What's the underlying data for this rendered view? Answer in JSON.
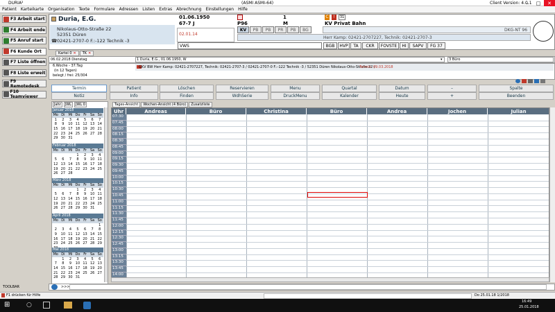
{
  "window": {
    "app": "DURIA²",
    "center": "(ASMI ASMI-64)",
    "version": "Client Version: 4.0.1"
  },
  "menu": [
    "Patient",
    "Karteikarte",
    "Organisation",
    "Texte",
    "Formulare",
    "Adressen",
    "Listen",
    "Extras",
    "Abrechnung",
    "Einstellungen",
    "Hilfe"
  ],
  "sidebar": [
    {
      "label": "F3 Arbeit start",
      "color": "#c0392b"
    },
    {
      "label": "F4 Arbeit ende",
      "color": "#2d7d2d"
    },
    {
      "label": "F5 Anruf start",
      "color": "#2d7d2d"
    },
    {
      "label": "F6 Kunde Ort",
      "color": "#c0392b"
    },
    {
      "label": "F7 Liste öffnen",
      "color": "#555555"
    },
    {
      "label": "F8 Liste erweit",
      "color": "#555555"
    },
    {
      "label": "F9 Remotedesk",
      "color": "#555555"
    },
    {
      "label": "F10 Teamviewer",
      "color": "#555555"
    }
  ],
  "toolbar_label": "TOOLBAR",
  "patient": {
    "name": "Duria, E.G.",
    "street": "Nikolaus-Otto-Straße 22",
    "city": "52351 Düren",
    "phone": "02421-2707-0 F.:-122 Technik -3",
    "dob": "01.06.1950",
    "age": "67-7 J",
    "num": "1",
    "sex": "M",
    "p_code": "P96",
    "insurance": "KV Privat Bahn",
    "date2": "02.01.14",
    "contact": "Herr Kamp: 02421-2707227,  Technik: 02421-2707-3",
    "dkg": "DKG-NT 96",
    "vws": "VWS"
  },
  "kv_tabs": [
    "KV",
    "PB",
    "PB",
    "PR",
    "PB",
    "BG"
  ],
  "bottom_tabs": [
    "BGB",
    "HVP",
    "TA",
    "CKR",
    "FOVSTE",
    "HI",
    "SAPV",
    "FG 37"
  ],
  "doc_tabs": [
    "Kartei 0",
    "TK"
  ],
  "info": {
    "date_line": "06.02.2018 Dienstag",
    "user_line": "1 Duria, E.G.,  01.06.1950, W",
    "room": "3 Büro",
    "week": "6.Woche - 37.Tag",
    "days_left": "(in 12 Tagen)",
    "booked": "belegt / frei:    25/304",
    "detail": "GKV BW Herr Kamp: 02421-2707227,  Technik: 02421-2707-3 / 02421-2707-0 F.:-122 Technik -3 / 52351 Düren Nikolaus-Otto-Straße 22 /",
    "term": "Termin: 09.03.2018"
  },
  "buttons_row1": [
    "Termin",
    "Patient",
    "Löschen",
    "Reservieren",
    "Menu",
    "Quartal",
    "Datum",
    "–",
    "Spalte"
  ],
  "buttons_row2": [
    "Notiz",
    "Info",
    "Finden",
    "WdhSerie",
    "DruckMenu",
    "Kalender",
    "Heute",
    "+",
    "Beenden"
  ],
  "cal_tabs": [
    "Jahr",
    "JWL",
    "JWL 0"
  ],
  "weekdays": [
    "Mo",
    "Di",
    "Mi",
    "Do",
    "Fr",
    "Sa",
    "So"
  ],
  "months": [
    {
      "name": "Januar 2018",
      "days": [
        "1",
        "2",
        "3",
        "4",
        "5",
        "6",
        "7",
        "8",
        "9",
        "10",
        "11",
        "12",
        "13",
        "14",
        "15",
        "16",
        "17",
        "18",
        "19",
        "20",
        "21",
        "22",
        "23",
        "24",
        "25",
        "26",
        "27",
        "28",
        "29",
        "30",
        "31"
      ],
      "offset": 0
    },
    {
      "name": "Februar 2018",
      "days": [
        "1",
        "2",
        "3",
        "4",
        "5",
        "6",
        "7",
        "8",
        "9",
        "10",
        "11",
        "12",
        "13",
        "14",
        "15",
        "16",
        "17",
        "18",
        "19",
        "20",
        "21",
        "22",
        "23",
        "24",
        "25",
        "26",
        "27",
        "28"
      ],
      "offset": 3
    },
    {
      "name": "März 2018",
      "days": [
        "1",
        "2",
        "3",
        "4",
        "5",
        "6",
        "7",
        "8",
        "9",
        "10",
        "11",
        "12",
        "13",
        "14",
        "15",
        "16",
        "17",
        "18",
        "19",
        "20",
        "21",
        "22",
        "23",
        "24",
        "25",
        "26",
        "27",
        "28",
        "29",
        "30",
        "31"
      ],
      "offset": 3
    },
    {
      "name": "April 2018",
      "days": [
        "1",
        "2",
        "3",
        "4",
        "5",
        "6",
        "7",
        "8",
        "9",
        "10",
        "11",
        "12",
        "13",
        "14",
        "15",
        "16",
        "17",
        "18",
        "19",
        "20",
        "21",
        "22",
        "23",
        "24",
        "25",
        "26",
        "27",
        "28",
        "29",
        "30"
      ],
      "offset": 6
    },
    {
      "name": "Mai 2018",
      "days": [
        "1",
        "2",
        "3",
        "4",
        "5",
        "6",
        "7",
        "8",
        "9",
        "10",
        "11",
        "12",
        "13",
        "14",
        "15",
        "16",
        "17",
        "18",
        "19",
        "20",
        "21",
        "22",
        "23",
        "24",
        "25",
        "26",
        "27",
        "28",
        "29",
        "30",
        "31"
      ],
      "offset": 1
    }
  ],
  "sched_tabs": [
    "Tages-Ansicht",
    "Wochen-Ansicht (4 Büro)",
    "Zusatzliste"
  ],
  "columns": [
    "Uhr",
    "Andreas",
    "Büro",
    "Christina",
    "Büro",
    "Andrea",
    "Jochen",
    "Julian"
  ],
  "times": [
    "07:30",
    "07:45",
    "08:00",
    "08:15",
    "08:30",
    "08:45",
    "09:00",
    "09:15",
    "09:30",
    "09:45",
    "10:00",
    "10:15",
    "10:30",
    "10:45",
    "11:00",
    "11:15",
    "11:30",
    "11:45",
    "12:00",
    "12:15",
    "12:30",
    "12:45",
    "13:00",
    "13:15",
    "13:30",
    "13:45",
    "14:00"
  ],
  "cmd_prompt": ">>>",
  "status": {
    "hint": "F1 drücken für Hilfe",
    "date": "Do 25.01.18   1/2018"
  },
  "taskbar": {
    "time": "16:49",
    "date": "25.01.2018"
  }
}
